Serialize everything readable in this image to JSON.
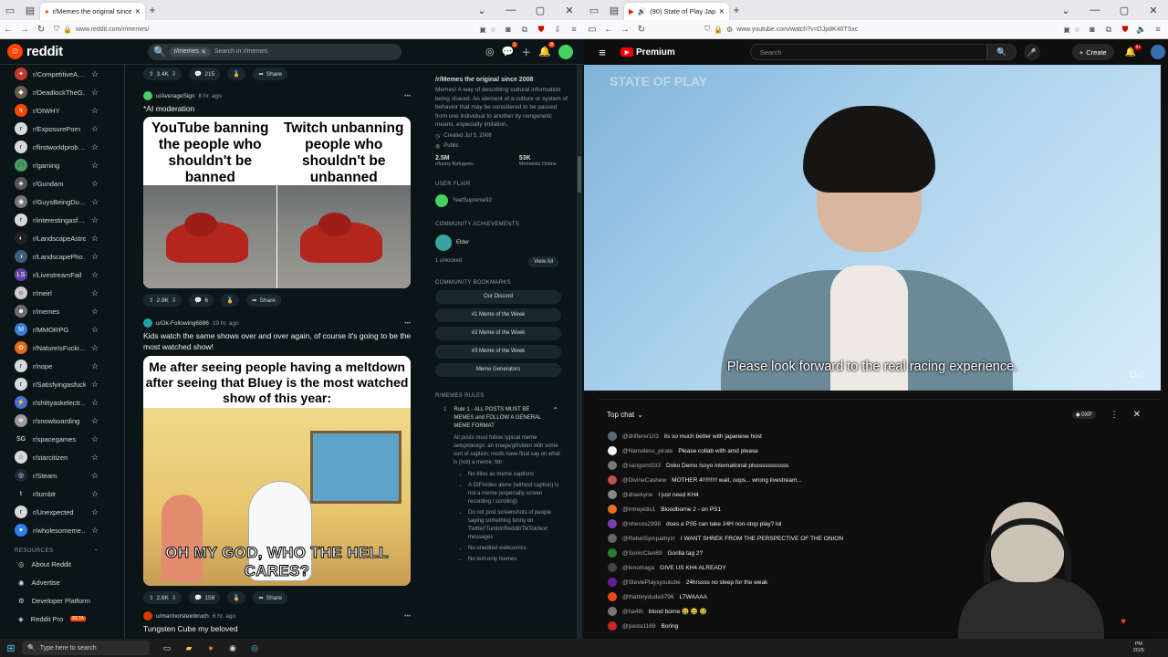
{
  "left_browser": {
    "tab_title": "r/Memes the original since 20…",
    "url": "www.reddit.com/r/memes/"
  },
  "right_browser": {
    "tab_title": "(90) State of Play Japan | N…",
    "url": "www.youtube.com/watch?v=DJp8K40TSxc"
  },
  "reddit": {
    "logo_text": "reddit",
    "search_chip": "r/memes",
    "search_placeholder": "Search in r/memes",
    "notif_badge_1": "1",
    "notif_badge_2": "8",
    "sidebar_items": [
      {
        "name": "r/CompetitiveA…",
        "color": "#c0392b",
        "glyph": "✦"
      },
      {
        "name": "r/DeadlockTheG…",
        "color": "#6b5d4a",
        "glyph": "◆"
      },
      {
        "name": "r/DIWHY",
        "color": "#ff4500",
        "glyph": "↯"
      },
      {
        "name": "r/ExposurePorn",
        "color": "#d7dadc",
        "glyph": "r"
      },
      {
        "name": "r/firstworldprob…",
        "color": "#d7dadc",
        "glyph": "r"
      },
      {
        "name": "r/gaming",
        "color": "#3ba55d",
        "glyph": "🎮"
      },
      {
        "name": "r/Gundam",
        "color": "#555555",
        "glyph": "◈"
      },
      {
        "name": "r/GuysBeingDu…",
        "color": "#777777",
        "glyph": "◉"
      },
      {
        "name": "r/interestingasf…",
        "color": "#d7dadc",
        "glyph": "r"
      },
      {
        "name": "r/LandscapeAstro",
        "color": "#222222",
        "glyph": "◐"
      },
      {
        "name": "r/LandscapePho…",
        "color": "#3b5e7a",
        "glyph": "◑"
      },
      {
        "name": "r/LivestreamFail",
        "color": "#6441a5",
        "glyph": "LS"
      },
      {
        "name": "r/meirl",
        "color": "#cccccc",
        "glyph": "☺"
      },
      {
        "name": "r/memes",
        "color": "#6c6c6c",
        "glyph": "☻"
      },
      {
        "name": "r/MMORPG",
        "color": "#3b7dd8",
        "glyph": "M"
      },
      {
        "name": "r/NatureIsFucki…",
        "color": "#e86a1a",
        "glyph": "✿"
      },
      {
        "name": "r/nope",
        "color": "#d7dadc",
        "glyph": "r"
      },
      {
        "name": "r/Satisfyingasfuck",
        "color": "#d7dadc",
        "glyph": "r"
      },
      {
        "name": "r/shittyaskelectr…",
        "color": "#4b6cd1",
        "glyph": "⚡"
      },
      {
        "name": "r/snowboarding",
        "color": "#999999",
        "glyph": "❄"
      },
      {
        "name": "r/spacegames",
        "color": "#0b1416",
        "glyph": "SG"
      },
      {
        "name": "r/starcitizen",
        "color": "#d7dadc",
        "glyph": "☆"
      },
      {
        "name": "r/Steam",
        "color": "#1b2838",
        "glyph": "◎"
      },
      {
        "name": "r/tumblr",
        "color": "#0b1416",
        "glyph": "t"
      },
      {
        "name": "r/Unexpected",
        "color": "#d7dadc",
        "glyph": "r"
      },
      {
        "name": "r/wholesomeme…",
        "color": "#2f80ed",
        "glyph": "♥"
      }
    ],
    "resources_heading": "RESOURCES",
    "resources": [
      {
        "label": "About Reddit",
        "icon": "◎"
      },
      {
        "label": "Advertise",
        "icon": "◉"
      },
      {
        "label": "Developer Platform",
        "icon": "⚙"
      },
      {
        "label": "Reddit Pro",
        "icon": "◈",
        "badge": "BETA"
      }
    ],
    "feed": {
      "top_actions": {
        "votes": "3.4K",
        "comments": "215",
        "share": "Share"
      },
      "post1": {
        "author": "u/AverageSign",
        "ago": "8 hr. ago",
        "title": "*AI moderation",
        "caption_left": "YouTube banning the people who shouldn't be banned",
        "caption_right": "Twitch unbanning people who shouldn't be unbanned",
        "votes": "2.9K",
        "comments": "6",
        "share": "Share"
      },
      "post2": {
        "author": "u/Ok-Following6886",
        "ago": "19 hr. ago",
        "title": "Kids watch the same shows over and over again, of course it's going to be the most watched show!",
        "caption_top": "Me after seeing people having a meltdown after seeing that Bluey is the most watched show of this year:",
        "caption_bottom": "OH MY GOD, WHO THE HELL CARES?",
        "votes": "2.8K",
        "comments": "158",
        "share": "Share"
      },
      "post3": {
        "author": "u/marmorsteinbruch",
        "ago": "6 hr. ago",
        "title": "Tungsten Cube my beloved"
      }
    },
    "right_rail": {
      "title": "/r/Memes the original since 2008",
      "description": "Memes! A way of describing cultural information being shared. An element of a culture or system of behavior that may be considered to be passed from one individual to another by nongenetic means, especially imitation.",
      "created": "Created Jul 5, 2008",
      "visibility": "Public",
      "members": "2.5M",
      "members_label": "r/funny Refugees",
      "online": "53K",
      "online_label": "Memeists Online",
      "user_flair_heading": "USER FLAIR",
      "user_flair_name": "YeetSupreme92",
      "achievements_heading": "COMMUNITY ACHIEVEMENTS",
      "achievement_name": "Elder",
      "unlocked": "1 unlocked",
      "view_all": "View All",
      "bookmarks_heading": "COMMUNITY BOOKMARKS",
      "bookmarks": [
        "Our Discord",
        "#1 Meme of the Week",
        "#2 Meme of the Week",
        "#3 Meme of the Week",
        "Meme Generators"
      ],
      "rules_heading": "R/MEMES RULES",
      "rule1_num": "1",
      "rule1_title": "Rule 1 - ALL POSTS MUST BE MEMES and FOLLOW A GENERAL MEME FORMAT",
      "rule1_text": "All posts must follow typical meme setup/design: an image/gif/video with some sort of caption; mods have final say on what is (not) a meme; tldr:",
      "rule1_bullets": [
        "No titles as meme captions",
        "A GIF/video alone (without caption) is not a meme (especially screen recording / scrolling)",
        "Do not post screenshots of people saying something funny on Twitter/Tumblr/Reddit/TikTok/text messages",
        "No unedited webcomics",
        "No text-only memes"
      ]
    }
  },
  "youtube": {
    "logo_text": "Premium",
    "search_placeholder": "Search",
    "create_label": "Create",
    "notif_badge": "9+",
    "subtitle": "Please look forward to the real racing experience.",
    "watermark": "STATE OF PLAY",
    "chat_mode": "Top chat",
    "points_pill": "0XP",
    "messages": [
      {
        "user": "@drifterer103",
        "text": "its so much better with japanese host",
        "color": "#5b6b73"
      },
      {
        "user": "@Nameless_pirate",
        "text": "Please collab with amd please",
        "color": "#f1f1f1"
      },
      {
        "user": "@sangumi333",
        "text": "Doko Demo Issyo international plssssssssssss",
        "color": "#777777"
      },
      {
        "user": "@DivineCashew",
        "text": "MOTHER 4!!!!!!!!! wait, oops... wrong livestream...",
        "color": "#c05050"
      },
      {
        "user": "@draekyne",
        "text": "I just need KH4",
        "color": "#888888"
      },
      {
        "user": "@intrepidis1",
        "text": "Bloodborne 2 - on PS1",
        "color": "#e0701e"
      },
      {
        "user": "@nhecos2998",
        "text": "does a PS5 can take 24H non-stop play? lol",
        "color": "#7b3fb5"
      },
      {
        "user": "@RebelSympathyzr",
        "text": "I WANT SHREK FROM THE PERSPECTIVE OF THE ONION",
        "color": "#666666"
      },
      {
        "user": "@SonicClan89",
        "text": "Gorilla tag 2?",
        "color": "#2e7d32"
      },
      {
        "user": "@lenomaga",
        "text": "GIVE US KH4 ALREADY",
        "color": "#444444"
      },
      {
        "user": "@SteviePlaysyoutube",
        "text": "24hrssss no sleep for the weak",
        "color": "#6a1b9a"
      },
      {
        "user": "@thattinydude9796",
        "text": "L7WAAAA",
        "color": "#e64a19"
      },
      {
        "user": "@ha4th",
        "text": "blood borne 🤮 🤮 🤮",
        "color": "#777777"
      },
      {
        "user": "@pasta1169",
        "text": "Boring",
        "color": "#c62828"
      }
    ]
  },
  "taskbar": {
    "search_placeholder": "Type here to search",
    "time": "PM",
    "date": "2025"
  }
}
